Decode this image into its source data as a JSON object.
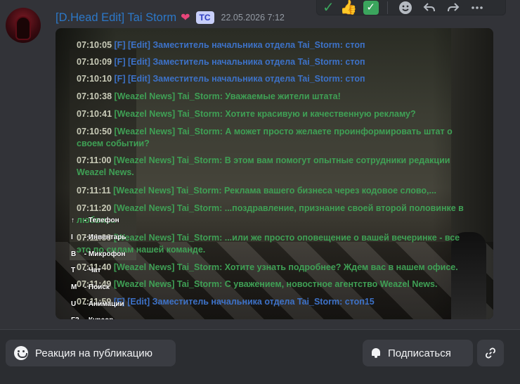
{
  "message": {
    "author": "[D.Head Edit] Tai Storm",
    "author_emoji": "❤",
    "tag": "TC",
    "timestamp": "22.05.2026 7:12"
  },
  "toolbar": {
    "reaction_check": "✓",
    "reaction_thumbs": "👍",
    "reaction_box_check": "✓"
  },
  "chat_log": [
    {
      "time": "07:10:05",
      "text": "[F] [Edit] Заместитель начальника отдела Tai_Storm: стоп",
      "color": "#3d72c8"
    },
    {
      "time": "07:10:09",
      "text": "[F] [Edit] Заместитель начальника отдела Tai_Storm: стоп",
      "color": "#3d72c8"
    },
    {
      "time": "07:10:10",
      "text": "[F] [Edit] Заместитель начальника отдела Tai_Storm: стоп",
      "color": "#3d72c8"
    },
    {
      "time": "07:10:38",
      "text": "[Weazel News] Tai_Storm: Уважаемые жители штата!",
      "color": "#3fa055"
    },
    {
      "time": "07:10:41",
      "text": "[Weazel News] Tai_Storm: Хотите красивую и качественную рекламу?",
      "color": "#3fa055"
    },
    {
      "time": "07:10:50",
      "text": "[Weazel News] Tai_Storm: А может просто желаете проинформировать штат о",
      "text2": "своем событии?",
      "color": "#3fa055"
    },
    {
      "time": "07:11:00",
      "text": "[Weazel News] Tai_Storm: В этом вам помогут опытные сотрудники редакции",
      "text2": "Weazel News.",
      "color": "#3fa055"
    },
    {
      "time": "07:11:11",
      "text": "[Weazel News] Tai_Storm: Реклама вашего бизнеса через кодовое слово,...",
      "color": "#3fa055"
    },
    {
      "time": "07:11:20",
      "text": "[Weazel News] Tai_Storm: ...поздравление, признание своей второй половинке в",
      "text2": "любви,...",
      "color": "#3fa055"
    },
    {
      "time": "07:11:30",
      "text": "[Weazel News] Tai_Storm: ...или же просто оповещение о вашей вечеринке - все",
      "text2": "это по силам нашей команде.",
      "color": "#3fa055"
    },
    {
      "time": "07:11:40",
      "text": "[Weazel News] Tai_Storm: Хотите узнать подробнее? Ждем вас в нашем офисе.",
      "color": "#3fa055"
    },
    {
      "time": "07:11:49",
      "text": "[Weazel News] Tai_Storm: С уважением, новостное агентство Weazel News.",
      "color": "#3fa055"
    },
    {
      "time": "07:11:59",
      "text": "[F] [Edit] Заместитель начальника отдела Tai_Storm: стоп15",
      "color": "#3d72c8"
    }
  ],
  "hud_keys": [
    {
      "key": "↑",
      "label": "- Телефон"
    },
    {
      "key": "I",
      "label": "- Инвентарь"
    },
    {
      "key": "B",
      "label": "- Микрофон"
    },
    {
      "key": "T",
      "label": "- Чат"
    },
    {
      "key": "M",
      "label": "- Поиск"
    },
    {
      "key": "U",
      "label": "- Анимации"
    },
    {
      "key": "F2",
      "label": "- Курсор"
    }
  ],
  "bottom_bar": {
    "react_label": "Реакция на публикацию",
    "subscribe_label": "Подписаться"
  },
  "colors": {
    "author": "#2c78c8",
    "tag_bg": "#c8cffa",
    "faction_blue": "#3d72c8",
    "news_green": "#3fa055"
  }
}
